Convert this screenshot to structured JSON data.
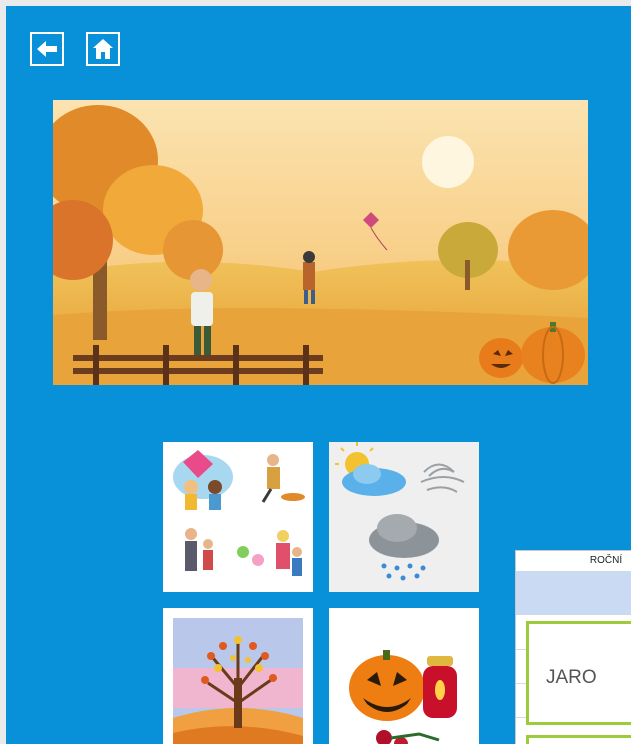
{
  "nav": {
    "back_icon": "arrow-left-icon",
    "home_icon": "home-icon"
  },
  "colors": {
    "panel_background": "#0891d8",
    "season_border": "#9ccc3c",
    "header_band": "#c9daf2"
  },
  "hero": {
    "scene": "autumn-park-illustration"
  },
  "tiles": [
    {
      "id": "activities",
      "icon": "autumn-activities-picture"
    },
    {
      "id": "weather",
      "icon": "weather-picture"
    },
    {
      "id": "tree",
      "icon": "autumn-tree-picture"
    },
    {
      "id": "halloween",
      "icon": "pumpkin-lantern-picture"
    }
  ],
  "popup": {
    "title": "ROČNÍ",
    "season_label": "JARO"
  }
}
